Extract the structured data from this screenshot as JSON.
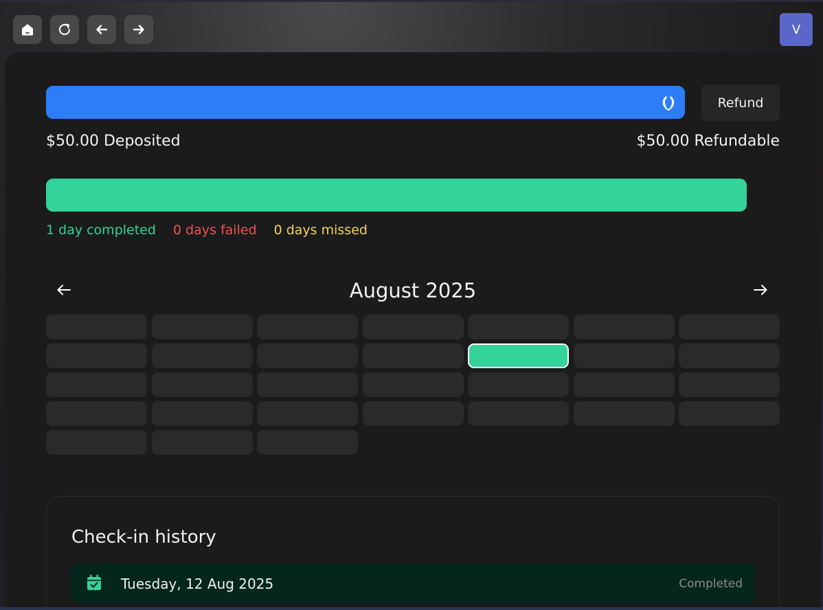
{
  "toolbar": {
    "avatar_initial": "V"
  },
  "deposit": {
    "deposited_label": "$50.00 Deposited",
    "refundable_label": "$50.00 Refundable",
    "refund_button": "Refund",
    "bar_color": "#2e7df8"
  },
  "progress": {
    "fraction": 1.0,
    "completed_label": "1 day completed",
    "failed_label": "0 days failed",
    "missed_label": "0 days missed",
    "colors": {
      "completed": "#34d399",
      "failed": "#f05252",
      "missed": "#f4d35e"
    }
  },
  "calendar": {
    "month_label": "August 2025",
    "days_in_month": 31,
    "completed_days": [
      12
    ],
    "prev_icon": "arrow-left-icon",
    "next_icon": "arrow-right-icon"
  },
  "history": {
    "title": "Check-in history",
    "entries": [
      {
        "date": "Tuesday, 12 Aug 2025",
        "status": "Completed",
        "icon": "calendar-check-icon"
      }
    ]
  }
}
